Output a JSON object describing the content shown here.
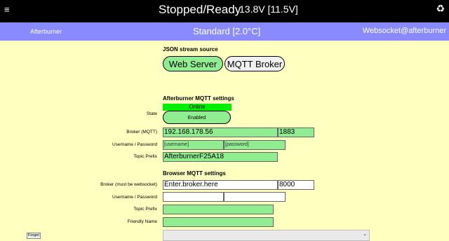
{
  "header": {
    "status": "Stopped/Ready",
    "voltage": "13.8V [11.5V]",
    "menu_icon": "≡",
    "recycle_icon": "♻"
  },
  "modebar": {
    "left": "Afterburner",
    "center": "Standard [2.0°C]",
    "right": "Websocket@afterburner"
  },
  "json_source": {
    "title": "JSON stream source",
    "web_server": "Web Server",
    "mqtt_broker": "MQTT Broker"
  },
  "afterburner_mqtt": {
    "title": "Afterburner MQTT settings",
    "state_label": "State",
    "state_status": "Online",
    "state_button": "Enabled",
    "broker_label": "Broker (MQTT)",
    "broker_host": "192.168.178.56",
    "broker_port": "1883",
    "userpass_label": "Username / Password",
    "username": "[username]",
    "password": "[password]",
    "topic_label": "Topic Prefix",
    "topic": "AfterburnerF25A18"
  },
  "browser_mqtt": {
    "title": "Browser MQTT settings",
    "broker_label": "Broker (must be websocket)",
    "broker_host": "Enter.broker.here",
    "broker_port": "8000",
    "userpass_label": "Username / Password",
    "username": "",
    "password": "",
    "topic_label": "Topic Prefix",
    "topic": "",
    "friendly_label": "Friendly Name",
    "friendly": "",
    "forget": "Forget",
    "select_arrow": "⌄"
  }
}
